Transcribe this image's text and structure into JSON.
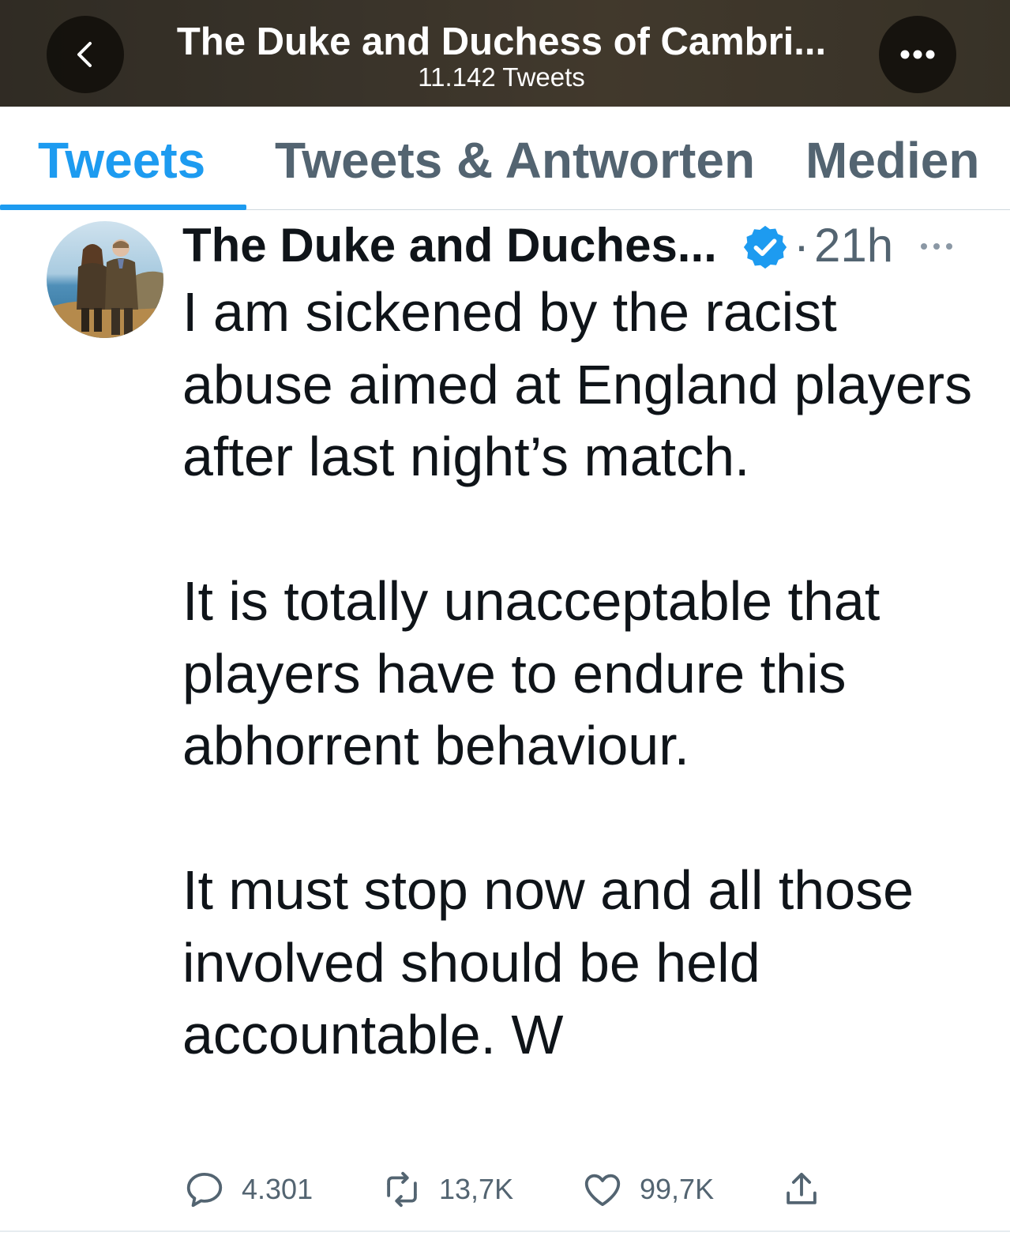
{
  "header": {
    "title": "The Duke and Duchess of Cambri...",
    "subtitle": "11.142 Tweets",
    "back_icon": "chevron-left-icon",
    "more_icon": "ellipsis-icon"
  },
  "tabs": [
    {
      "label": "Tweets",
      "active": true
    },
    {
      "label": "Tweets & Antworten",
      "active": false
    },
    {
      "label": "Medien",
      "active": false
    }
  ],
  "tweet": {
    "author": "The Duke and Duches...",
    "verified": true,
    "separator": "·",
    "time": "21h",
    "paragraphs": [
      "I am sickened by the racist abuse aimed at England players after last night’s match.",
      "It is totally unacceptable that players have to endure this abhorrent behaviour.",
      "It must stop now and all those involved should be held accountable. W"
    ],
    "stats": {
      "replies": "4.301",
      "retweets": "13,7K",
      "likes": "99,7K"
    }
  },
  "colors": {
    "accent": "#1d9bf0",
    "text_primary": "#0f1419",
    "text_secondary": "#536471"
  }
}
